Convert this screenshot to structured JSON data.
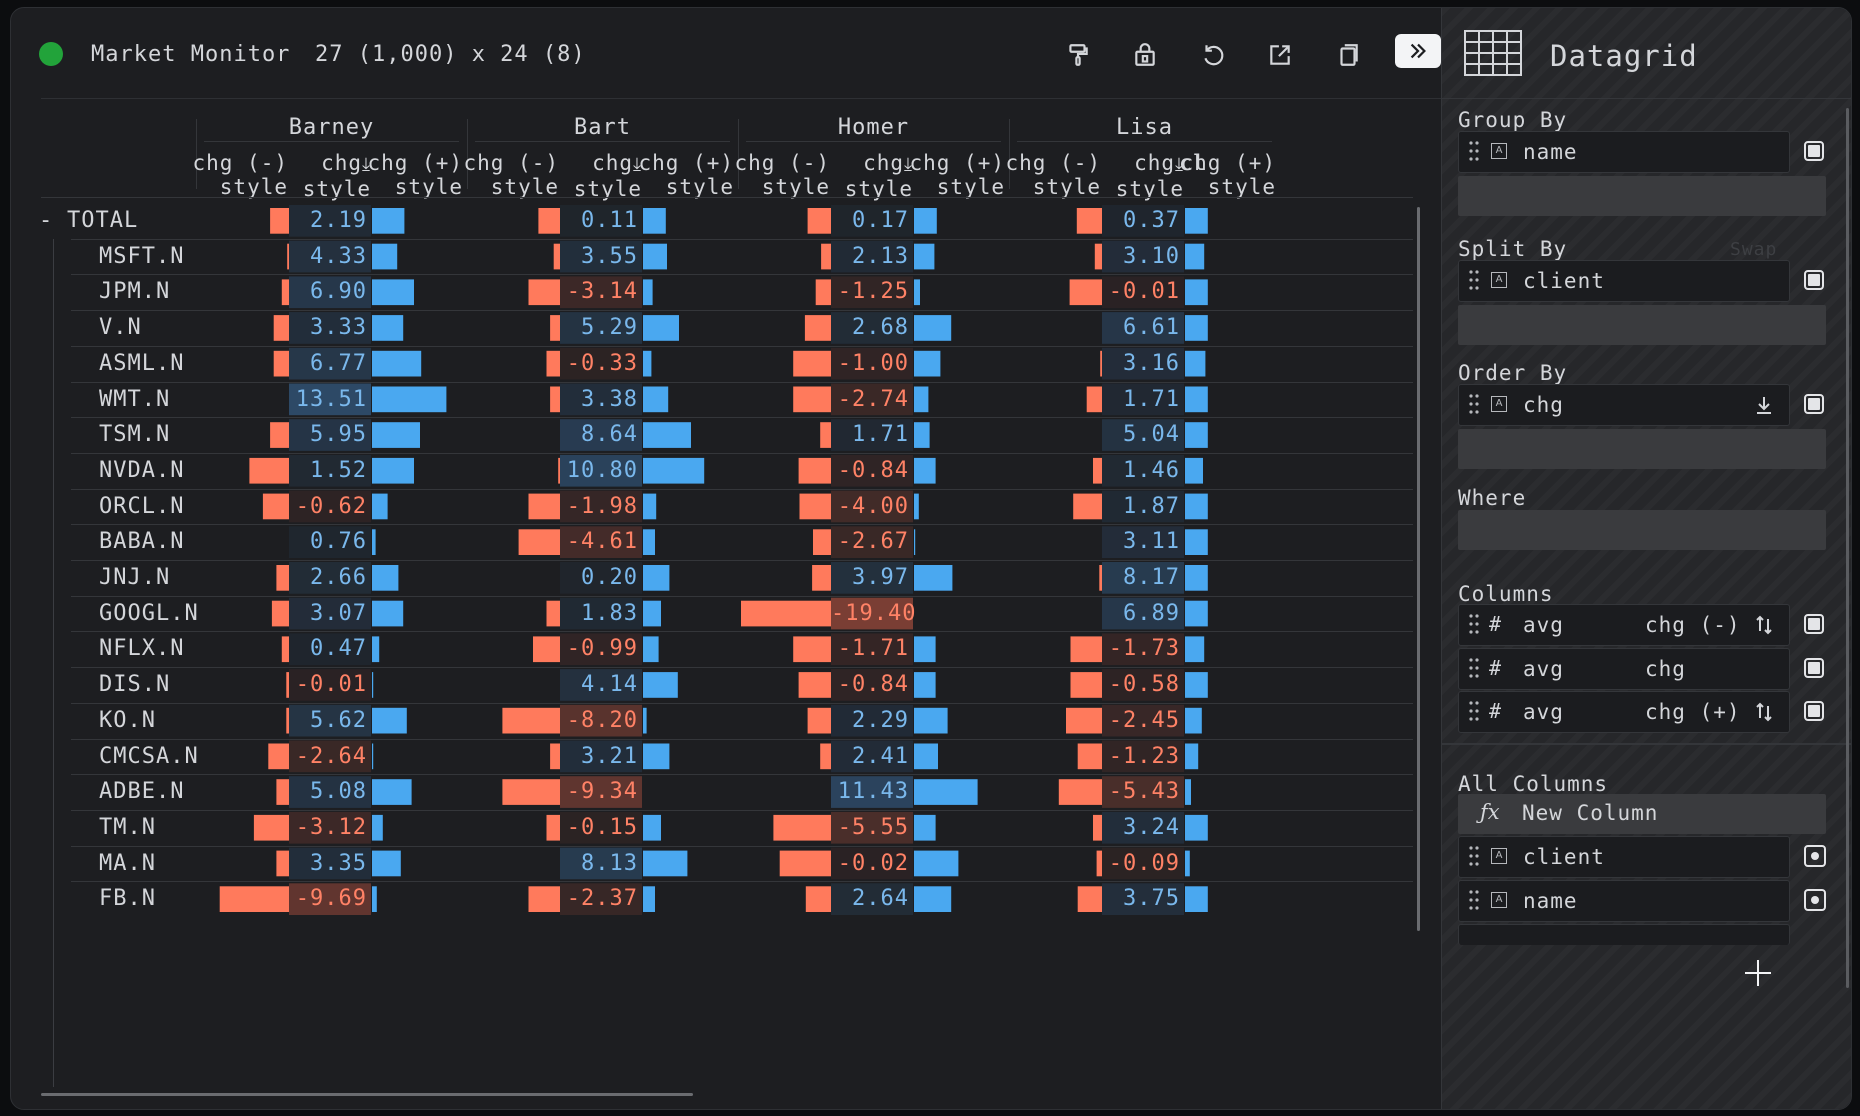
{
  "titlebar": {
    "title": "Market Monitor",
    "dims": "27 (1,000) x 24 (8)",
    "status_color": "#22a33a",
    "icons": [
      "paint-format-icon",
      "lock-icon",
      "reset-icon",
      "export-icon",
      "copy-icon",
      "double-chevron-right-icon"
    ]
  },
  "grid": {
    "clients": [
      "Barney",
      "Bart",
      "Homer",
      "Lisa"
    ],
    "columns": [
      {
        "line1": "chg (-)",
        "line2": "style"
      },
      {
        "line1": "chg",
        "line2": "style",
        "sort_icon": "sort-desc-icon"
      },
      {
        "line1": "chg (+)",
        "line2": "style"
      }
    ],
    "cut_column": "cl",
    "negative_color": "#ff7a5c",
    "positive_color": "#4aa8f0",
    "total_toggle": "-",
    "rows": [
      {
        "name": "TOTAL",
        "values": [
          2.19,
          0.11,
          0.17,
          0.37
        ]
      },
      {
        "name": "MSFT.N",
        "values": [
          4.33,
          3.55,
          2.13,
          3.1
        ]
      },
      {
        "name": "JPM.N",
        "values": [
          6.9,
          -3.14,
          -1.25,
          -0.01
        ]
      },
      {
        "name": "V.N",
        "values": [
          3.33,
          5.29,
          2.68,
          6.61
        ]
      },
      {
        "name": "ASML.N",
        "values": [
          6.77,
          -0.33,
          -1.0,
          3.16
        ]
      },
      {
        "name": "WMT.N",
        "values": [
          13.51,
          3.38,
          -2.74,
          1.71
        ]
      },
      {
        "name": "TSM.N",
        "values": [
          5.95,
          8.64,
          1.71,
          5.04
        ]
      },
      {
        "name": "NVDA.N",
        "values": [
          1.52,
          10.8,
          -0.84,
          1.46
        ]
      },
      {
        "name": "ORCL.N",
        "values": [
          -0.62,
          -1.98,
          -4.0,
          1.87
        ]
      },
      {
        "name": "BABA.N",
        "values": [
          0.76,
          -4.61,
          -2.67,
          3.11
        ]
      },
      {
        "name": "JNJ.N",
        "values": [
          2.66,
          0.2,
          3.97,
          8.17
        ]
      },
      {
        "name": "GOOGL.N",
        "values": [
          3.07,
          1.83,
          -19.4,
          6.89
        ]
      },
      {
        "name": "NFLX.N",
        "values": [
          0.47,
          -0.99,
          -1.71,
          -1.73
        ]
      },
      {
        "name": "DIS.N",
        "values": [
          -0.01,
          4.14,
          -0.84,
          -0.58
        ]
      },
      {
        "name": "KO.N",
        "values": [
          5.62,
          -8.2,
          2.29,
          -2.45
        ]
      },
      {
        "name": "CMCSA.N",
        "values": [
          -2.64,
          3.21,
          2.41,
          -1.23
        ]
      },
      {
        "name": "ADBE.N",
        "values": [
          5.08,
          -9.34,
          11.43,
          -5.43
        ]
      },
      {
        "name": "TM.N",
        "values": [
          -3.12,
          -0.15,
          -5.55,
          3.24
        ]
      },
      {
        "name": "MA.N",
        "values": [
          3.35,
          8.13,
          -0.02,
          -0.09
        ]
      },
      {
        "name": "FB.N",
        "values": [
          -9.69,
          -2.37,
          2.64,
          3.75
        ]
      }
    ],
    "neg_bar": [
      [
        0.21,
        0.24,
        0.26,
        0.28
      ],
      [
        0.02,
        0.07,
        0.11,
        0.08
      ],
      [
        0.08,
        0.35,
        0.17,
        0.36
      ],
      [
        0.17,
        0.11,
        0.29,
        0.0
      ],
      [
        0.17,
        0.15,
        0.42,
        0.02
      ],
      [
        0.0,
        0.11,
        0.42,
        0.17
      ],
      [
        0.21,
        0.0,
        0.12,
        0.0
      ],
      [
        0.44,
        0.02,
        0.36,
        0.1
      ],
      [
        0.29,
        0.35,
        0.35,
        0.32
      ],
      [
        0.0,
        0.46,
        0.2,
        0.0
      ],
      [
        0.14,
        0.0,
        0.21,
        0.03
      ],
      [
        0.19,
        0.15,
        1.0,
        0.0
      ],
      [
        0.08,
        0.3,
        0.42,
        0.35
      ],
      [
        0.03,
        0.0,
        0.36,
        0.35
      ],
      [
        0.03,
        0.64,
        0.26,
        0.4
      ],
      [
        0.23,
        0.11,
        0.12,
        0.27
      ],
      [
        0.14,
        0.64,
        0.0,
        0.48
      ],
      [
        0.39,
        0.15,
        0.64,
        0.1
      ],
      [
        0.14,
        0.0,
        0.57,
        0.06
      ],
      [
        0.77,
        0.35,
        0.28,
        0.27
      ]
    ],
    "pos_bar": [
      [
        0.27,
        0.19,
        0.19,
        0.19
      ],
      [
        0.21,
        0.2,
        0.17,
        0.16
      ],
      [
        0.35,
        0.08,
        0.05,
        0.19
      ],
      [
        0.26,
        0.3,
        0.31,
        0.19
      ],
      [
        0.41,
        0.07,
        0.22,
        0.17
      ],
      [
        0.62,
        0.21,
        0.12,
        0.19
      ],
      [
        0.4,
        0.4,
        0.13,
        0.19
      ],
      [
        0.35,
        0.51,
        0.18,
        0.15
      ],
      [
        0.13,
        0.11,
        0.04,
        0.19
      ],
      [
        0.03,
        0.1,
        0.01,
        0.19
      ],
      [
        0.22,
        0.22,
        0.32,
        0.19
      ],
      [
        0.26,
        0.15,
        0.0,
        0.19
      ],
      [
        0.06,
        0.13,
        0.18,
        0.16
      ],
      [
        0.01,
        0.29,
        0.18,
        0.19
      ],
      [
        0.29,
        0.03,
        0.28,
        0.14
      ],
      [
        0.01,
        0.22,
        0.2,
        0.11
      ],
      [
        0.33,
        0.0,
        0.53,
        0.05
      ],
      [
        0.09,
        0.15,
        0.18,
        0.19
      ],
      [
        0.24,
        0.37,
        0.37,
        0.04
      ],
      [
        0.04,
        0.1,
        0.31,
        0.19
      ]
    ]
  },
  "panel": {
    "title": "Datagrid",
    "group_by": {
      "label": "Group By",
      "items": [
        {
          "name": "name",
          "type_icon": "text-type-icon"
        }
      ]
    },
    "split_by": {
      "label": "Split By",
      "swap": "Swap",
      "items": [
        {
          "name": "client",
          "type_icon": "text-type-icon"
        }
      ]
    },
    "order_by": {
      "label": "Order By",
      "items": [
        {
          "name": "chg",
          "type_icon": "text-type-icon",
          "order_icon": "sort-desc-icon"
        }
      ]
    },
    "where": {
      "label": "Where"
    },
    "columns": {
      "label": "Columns",
      "items": [
        {
          "type": "#",
          "agg": "avg",
          "name": "chg (-)",
          "icon": "style-settings-icon"
        },
        {
          "type": "#",
          "agg": "avg",
          "name": "chg",
          "icon": ""
        },
        {
          "type": "#",
          "agg": "avg",
          "name": "chg (+)",
          "icon": "style-settings-icon"
        }
      ]
    },
    "all_columns": {
      "label": "All Columns",
      "new_column": {
        "fx": "ƒx",
        "label": "New Column"
      },
      "items": [
        {
          "name": "client",
          "type_icon": "text-type-icon"
        },
        {
          "name": "name",
          "type_icon": "text-type-icon"
        }
      ]
    }
  }
}
